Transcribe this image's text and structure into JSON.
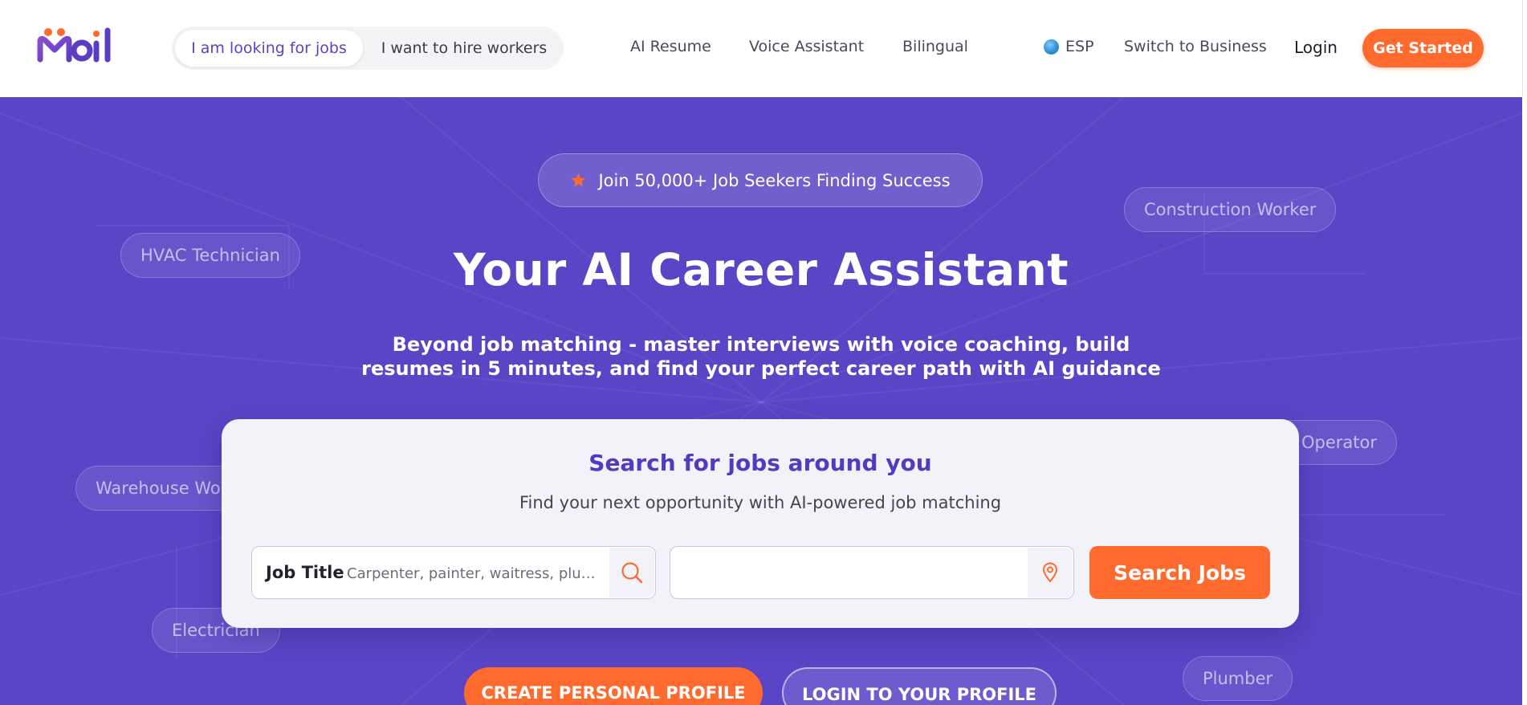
{
  "header": {
    "logo_alt": "Moil",
    "segmented": {
      "job_seeker": "I am looking for jobs",
      "employer": "I want to hire workers"
    },
    "nav": {
      "ai_resume": "AI Resume",
      "voice_assistant": "Voice Assistant",
      "bilingual": "Bilingual"
    },
    "language": "ESP",
    "switch_business": "Switch to Business",
    "login": "Login",
    "get_started": "Get Started"
  },
  "hero": {
    "badge": "Join 50,000+ Job Seekers Finding Success",
    "title": "Your AI Career Assistant",
    "subtitle": "Beyond job matching - master interviews with voice coaching, build resumes in 5 minutes, and find your perfect career path with AI guidance",
    "floating_tags": {
      "construction": "Construction Worker",
      "hvac": "HVAC Technician",
      "operator": "Operator",
      "warehouse": "Warehouse Wo",
      "electrician": "Electrician",
      "plumber": "Plumber"
    }
  },
  "search_card": {
    "title": "Search for jobs around you",
    "subtitle": "Find your next opportunity with AI-powered job matching",
    "job_label": "Job Title",
    "job_placeholder": "Carpenter, painter, waitress, plum...",
    "location_value": "",
    "search_button": "Search Jobs"
  },
  "ctas": {
    "create_profile": "CREATE PERSONAL PROFILE",
    "login_profile": "LOGIN TO YOUR PROFILE"
  },
  "colors": {
    "brand_purple": "#5a45c6",
    "accent_orange": "#ff6a2e",
    "title_purple": "#4f3cc0"
  }
}
